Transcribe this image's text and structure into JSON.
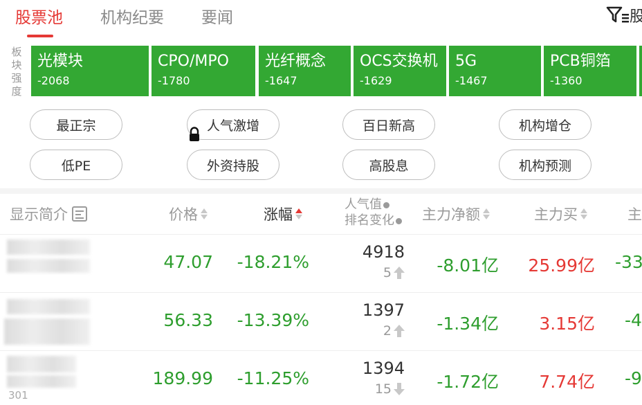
{
  "tabs": [
    {
      "label": "股票池",
      "active": true
    },
    {
      "label": "机构纪要",
      "active": false
    },
    {
      "label": "要闻",
      "active": false
    }
  ],
  "filter": {
    "icon": "filter-icon",
    "label": "股"
  },
  "sector_label": "板块强度",
  "sectors": [
    {
      "name": "光模块",
      "value": "-2068"
    },
    {
      "name": "CPO/MPO",
      "value": "-1780"
    },
    {
      "name": "光纤概念",
      "value": "-1647"
    },
    {
      "name": "OCS交换机",
      "value": "-1629"
    },
    {
      "name": "5G",
      "value": "-1467"
    },
    {
      "name": "PCB铜箔",
      "value": "-1360"
    }
  ],
  "chips": [
    "最正宗",
    "人气激增",
    "百日新高",
    "机构增仓",
    "低PE",
    "外资持股",
    "高股息",
    "机构预测"
  ],
  "columns": {
    "desc": "显示简介",
    "price": "价格",
    "change": "涨幅",
    "popularity_line1": "人气值",
    "popularity_line2": "排名变化",
    "net_flow": "主力净额",
    "main_buy": "主力买",
    "main_sell_partial": "主"
  },
  "rows": [
    {
      "price": "47.07",
      "change": "-18.21%",
      "popularity": "4918",
      "rank_change": "5",
      "rank_dir": "up",
      "net_flow": "-8.01亿",
      "main_buy": "25.99亿",
      "main_sell_partial": "-33"
    },
    {
      "price": "56.33",
      "change": "-13.39%",
      "popularity": "1397",
      "rank_change": "2",
      "rank_dir": "up",
      "net_flow": "-1.34亿",
      "main_buy": "3.15亿",
      "main_sell_partial": "-4"
    },
    {
      "price": "189.99",
      "change": "-11.25%",
      "popularity": "1394",
      "rank_change": "15",
      "rank_dir": "down",
      "net_flow": "-1.72亿",
      "main_buy": "7.74亿",
      "main_sell_partial": "-9"
    }
  ],
  "partial_code": "301",
  "colors": {
    "accent": "#e53935",
    "sector_green": "#33a833",
    "down_green": "#2e9e2e",
    "up_red": "#e53935"
  }
}
